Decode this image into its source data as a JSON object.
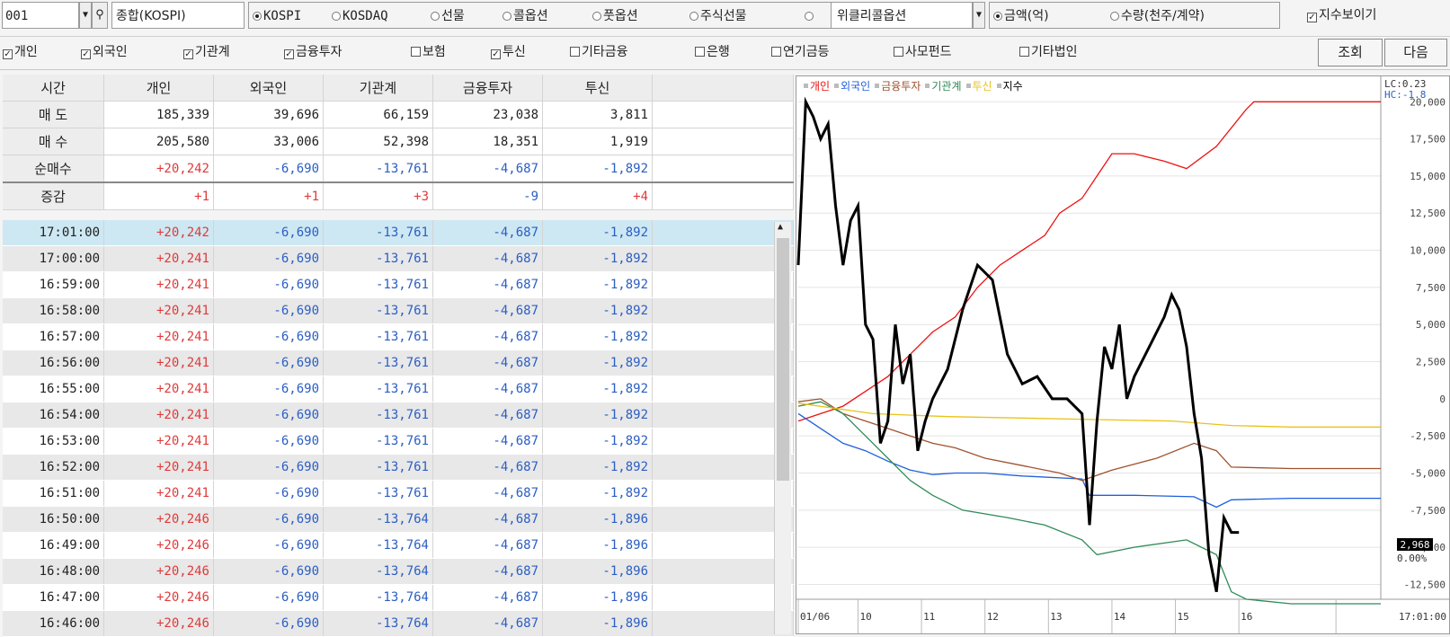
{
  "toolbar": {
    "code": "001",
    "index_name": "종합(KOSPI)",
    "markets": [
      "KOSPI",
      "KOSDAQ",
      "선물",
      "콜옵션",
      "풋옵션",
      "주식선물",
      ""
    ],
    "market_selected": 0,
    "option_select": "위클리콜옵션",
    "units": [
      "금액(억)",
      "수량(천주/계약)"
    ],
    "unit_selected": 0,
    "show_index_label": "지수보이기",
    "show_index_checked": true
  },
  "filters": {
    "items": [
      {
        "label": "개인",
        "checked": true
      },
      {
        "label": "외국인",
        "checked": true
      },
      {
        "label": "기관계",
        "checked": true
      },
      {
        "label": "금융투자",
        "checked": true
      },
      {
        "label": "보험",
        "checked": false
      },
      {
        "label": "투신",
        "checked": true
      },
      {
        "label": "기타금융",
        "checked": false
      },
      {
        "label": "은행",
        "checked": false
      },
      {
        "label": "연기금등",
        "checked": false
      },
      {
        "label": "사모펀드",
        "checked": false
      },
      {
        "label": "기타법인",
        "checked": false
      }
    ],
    "query_button": "조회",
    "next_button": "다음"
  },
  "summary": {
    "headers": [
      "시간",
      "개인",
      "외국인",
      "기관계",
      "금융투자",
      "투신"
    ],
    "rows": [
      {
        "label": "매 도",
        "values": [
          "185,339",
          "39,696",
          "66,159",
          "23,038",
          "3,811"
        ]
      },
      {
        "label": "매 수",
        "values": [
          "205,580",
          "33,006",
          "52,398",
          "18,351",
          "1,919"
        ]
      },
      {
        "label": "순매수",
        "values": [
          "+20,242",
          "-6,690",
          "-13,761",
          "-4,687",
          "-1,892"
        ]
      },
      {
        "label": "증감",
        "values": [
          "+1",
          "+1",
          "+3",
          "-9",
          "+4"
        ]
      }
    ]
  },
  "detail_rows": [
    [
      "17:01:00",
      "+20,242",
      "-6,690",
      "-13,761",
      "-4,687",
      "-1,892"
    ],
    [
      "17:00:00",
      "+20,241",
      "-6,690",
      "-13,761",
      "-4,687",
      "-1,892"
    ],
    [
      "16:59:00",
      "+20,241",
      "-6,690",
      "-13,761",
      "-4,687",
      "-1,892"
    ],
    [
      "16:58:00",
      "+20,241",
      "-6,690",
      "-13,761",
      "-4,687",
      "-1,892"
    ],
    [
      "16:57:00",
      "+20,241",
      "-6,690",
      "-13,761",
      "-4,687",
      "-1,892"
    ],
    [
      "16:56:00",
      "+20,241",
      "-6,690",
      "-13,761",
      "-4,687",
      "-1,892"
    ],
    [
      "16:55:00",
      "+20,241",
      "-6,690",
      "-13,761",
      "-4,687",
      "-1,892"
    ],
    [
      "16:54:00",
      "+20,241",
      "-6,690",
      "-13,761",
      "-4,687",
      "-1,892"
    ],
    [
      "16:53:00",
      "+20,241",
      "-6,690",
      "-13,761",
      "-4,687",
      "-1,892"
    ],
    [
      "16:52:00",
      "+20,241",
      "-6,690",
      "-13,761",
      "-4,687",
      "-1,892"
    ],
    [
      "16:51:00",
      "+20,241",
      "-6,690",
      "-13,761",
      "-4,687",
      "-1,892"
    ],
    [
      "16:50:00",
      "+20,246",
      "-6,690",
      "-13,764",
      "-4,687",
      "-1,896"
    ],
    [
      "16:49:00",
      "+20,246",
      "-6,690",
      "-13,764",
      "-4,687",
      "-1,896"
    ],
    [
      "16:48:00",
      "+20,246",
      "-6,690",
      "-13,764",
      "-4,687",
      "-1,896"
    ],
    [
      "16:47:00",
      "+20,246",
      "-6,690",
      "-13,764",
      "-4,687",
      "-1,896"
    ],
    [
      "16:46:00",
      "+20,246",
      "-6,690",
      "-13,764",
      "-4,687",
      "-1,896"
    ]
  ],
  "colors": {
    "red": "#e03a3a",
    "blue": "#2b5ec4",
    "brown": "#a0522d",
    "green": "#2e8b57",
    "yellow": "#e8c31a",
    "black": "#000000"
  },
  "chart_data": {
    "type": "line",
    "legend": [
      "개인",
      "외국인",
      "금융투자",
      "기관계",
      "투신",
      "지수"
    ],
    "series_colors": [
      "#ee1111",
      "#1f5fdc",
      "#a0522d",
      "#2e8b57",
      "#e8c31a",
      "#000000"
    ],
    "x_labels": [
      "01/06",
      "10",
      "11",
      "12",
      "13",
      "14",
      "15",
      "16",
      "17:01:00"
    ],
    "y_ticks": [
      "20,000",
      "17,500",
      "15,000",
      "12,500",
      "10,000",
      "7,500",
      "5,000",
      "2,500",
      "0",
      "-2,500",
      "-5,000",
      "-7,500",
      "-10,000",
      "-12,500"
    ],
    "ylim": [
      -13500,
      20500
    ],
    "lc_label": "LC:0.23",
    "hc_label": "HC:-1.8",
    "index_value": "2,968",
    "index_pct": "0.00%",
    "series": [
      {
        "name": "개인",
        "values": [
          [
            0,
            -1500
          ],
          [
            3,
            -1000
          ],
          [
            6,
            -500
          ],
          [
            9,
            500
          ],
          [
            12,
            1500
          ],
          [
            15,
            3000
          ],
          [
            18,
            4500
          ],
          [
            21,
            5500
          ],
          [
            24,
            7500
          ],
          [
            27,
            9000
          ],
          [
            30,
            10000
          ],
          [
            33,
            11000
          ],
          [
            35,
            12500
          ],
          [
            38,
            13500
          ],
          [
            40,
            15000
          ],
          [
            42,
            16500
          ],
          [
            45,
            16500
          ],
          [
            49,
            16000
          ],
          [
            52,
            15500
          ],
          [
            56,
            17000
          ],
          [
            60,
            19500
          ],
          [
            61,
            20000
          ],
          [
            70,
            20000
          ],
          [
            78,
            20000
          ]
        ]
      },
      {
        "name": "외국인",
        "values": [
          [
            0,
            -1000
          ],
          [
            3,
            -2000
          ],
          [
            6,
            -3000
          ],
          [
            9,
            -3500
          ],
          [
            12,
            -4200
          ],
          [
            15,
            -4800
          ],
          [
            18,
            -5100
          ],
          [
            21,
            -5000
          ],
          [
            25,
            -5000
          ],
          [
            30,
            -5200
          ],
          [
            38,
            -5400
          ],
          [
            39,
            -6500
          ],
          [
            45,
            -6500
          ],
          [
            53,
            -6600
          ],
          [
            56,
            -7300
          ],
          [
            58,
            -6800
          ],
          [
            66,
            -6700
          ],
          [
            78,
            -6700
          ]
        ]
      },
      {
        "name": "금융투자",
        "values": [
          [
            0,
            -200
          ],
          [
            3,
            0
          ],
          [
            6,
            -1000
          ],
          [
            9,
            -1500
          ],
          [
            12,
            -2000
          ],
          [
            15,
            -2500
          ],
          [
            18,
            -3000
          ],
          [
            21,
            -3300
          ],
          [
            25,
            -4000
          ],
          [
            30,
            -4500
          ],
          [
            35,
            -5000
          ],
          [
            38,
            -5500
          ],
          [
            42,
            -4800
          ],
          [
            48,
            -4000
          ],
          [
            53,
            -3000
          ],
          [
            56,
            -3500
          ],
          [
            58,
            -4600
          ],
          [
            66,
            -4700
          ],
          [
            78,
            -4700
          ]
        ]
      },
      {
        "name": "기관계",
        "values": [
          [
            0,
            -500
          ],
          [
            3,
            -200
          ],
          [
            6,
            -1000
          ],
          [
            9,
            -2500
          ],
          [
            12,
            -4000
          ],
          [
            15,
            -5500
          ],
          [
            18,
            -6500
          ],
          [
            22,
            -7500
          ],
          [
            28,
            -8000
          ],
          [
            33,
            -8500
          ],
          [
            38,
            -9500
          ],
          [
            40,
            -10500
          ],
          [
            45,
            -10000
          ],
          [
            52,
            -9500
          ],
          [
            56,
            -10500
          ],
          [
            58,
            -13000
          ],
          [
            60,
            -13500
          ],
          [
            66,
            -13800
          ],
          [
            78,
            -13800
          ]
        ]
      },
      {
        "name": "투신",
        "values": [
          [
            0,
            -300
          ],
          [
            10,
            -1000
          ],
          [
            20,
            -1200
          ],
          [
            30,
            -1300
          ],
          [
            40,
            -1400
          ],
          [
            50,
            -1500
          ],
          [
            58,
            -1800
          ],
          [
            66,
            -1900
          ],
          [
            78,
            -1900
          ]
        ]
      },
      {
        "name": "지수",
        "values": [
          [
            0,
            9000
          ],
          [
            1,
            20000
          ],
          [
            2,
            19000
          ],
          [
            3,
            17500
          ],
          [
            4,
            18500
          ],
          [
            5,
            13000
          ],
          [
            6,
            9000
          ],
          [
            7,
            12000
          ],
          [
            8,
            13000
          ],
          [
            9,
            5000
          ],
          [
            10,
            4000
          ],
          [
            11,
            -3000
          ],
          [
            12,
            -1500
          ],
          [
            13,
            5000
          ],
          [
            14,
            1000
          ],
          [
            15,
            3000
          ],
          [
            16,
            -3500
          ],
          [
            17,
            -1500
          ],
          [
            18,
            0
          ],
          [
            20,
            2000
          ],
          [
            22,
            6000
          ],
          [
            24,
            9000
          ],
          [
            26,
            8000
          ],
          [
            28,
            3000
          ],
          [
            30,
            1000
          ],
          [
            32,
            1500
          ],
          [
            34,
            0
          ],
          [
            36,
            0
          ],
          [
            38,
            -1000
          ],
          [
            39,
            -8500
          ],
          [
            40,
            -1500
          ],
          [
            41,
            3500
          ],
          [
            42,
            2000
          ],
          [
            43,
            5000
          ],
          [
            44,
            0
          ],
          [
            45,
            1500
          ],
          [
            47,
            3500
          ],
          [
            49,
            5500
          ],
          [
            50,
            7000
          ],
          [
            51,
            6000
          ],
          [
            52,
            3500
          ],
          [
            53,
            -1000
          ],
          [
            54,
            -4000
          ],
          [
            55,
            -10500
          ],
          [
            56,
            -13000
          ],
          [
            57,
            -8000
          ],
          [
            58,
            -9000
          ],
          [
            59,
            -9000
          ]
        ]
      }
    ],
    "x_max": 78
  }
}
